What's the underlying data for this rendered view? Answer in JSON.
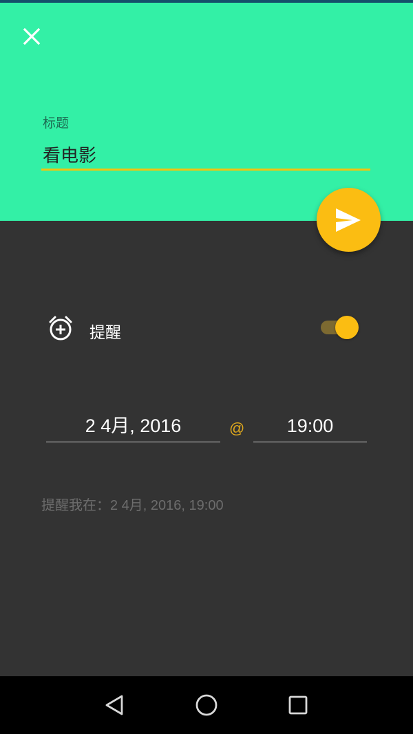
{
  "header": {
    "close_icon": "close-icon",
    "title_label": "标题",
    "title_value": "看电影",
    "background_color": "#33f0a6",
    "accent_color": "#fbbd12"
  },
  "send_button": {
    "icon": "send-icon"
  },
  "reminder": {
    "icon": "alarm-add-icon",
    "label": "提醒",
    "enabled": true
  },
  "schedule": {
    "date": "2 4月, 2016",
    "separator": "@",
    "time": "19:00"
  },
  "summary": {
    "prefix": "提醒我在：",
    "value": "2 4月, 2016, 19:00"
  },
  "navigation": {
    "back_icon": "back-triangle-icon",
    "home_icon": "home-circle-icon",
    "recents_icon": "recents-square-icon"
  }
}
